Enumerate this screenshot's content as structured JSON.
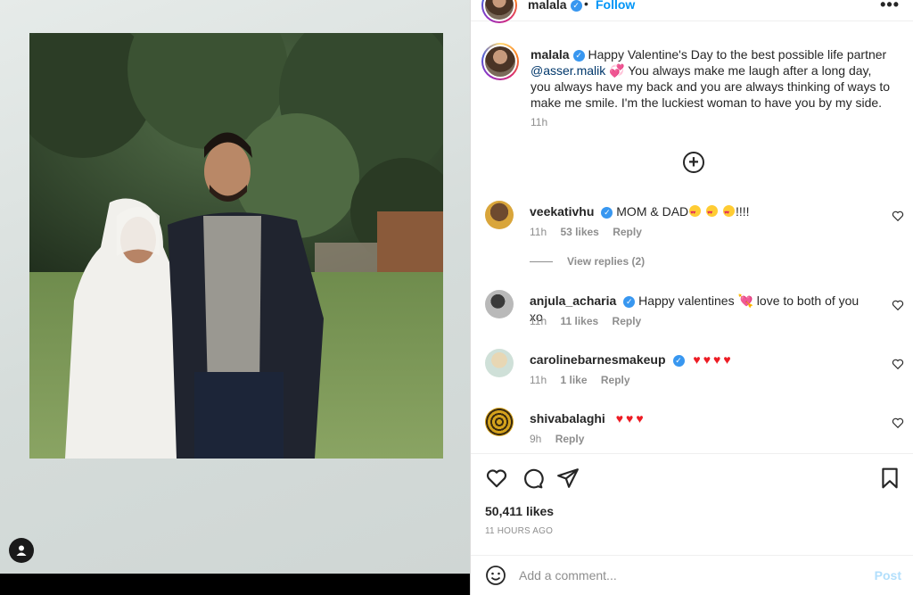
{
  "header": {
    "username": "malala",
    "separator": "•",
    "follow_label": "Follow",
    "more_label": "•••"
  },
  "caption": {
    "username": "malala",
    "text_before_mention": "Happy Valentine's Day to the best possible life partner",
    "mention": "@asser.malik",
    "text_after_mention": "You always make me laugh after a long day, you always have my back and you are always thinking of ways to make me smile. I'm the luckiest woman to have you by my side.",
    "time": "11h"
  },
  "comments": [
    {
      "username": "veekativhu",
      "verified": true,
      "text": "MOM & DAD",
      "suffix": "!!!!",
      "time": "11h",
      "likes": "53 likes",
      "reply": "Reply"
    },
    {
      "username": "anjula_acharia",
      "verified": true,
      "text": "Happy valentines",
      "suffix": "love to both of you xo",
      "time": "11h",
      "likes": "11 likes",
      "reply": "Reply"
    },
    {
      "username": "caroline barnes makeup",
      "display": "carolinebarnesmakeup",
      "verified": true,
      "text": "",
      "suffix": "",
      "time": "11h",
      "likes": "1 like",
      "reply": "Reply"
    },
    {
      "username": "shivabalaghi",
      "verified": false,
      "text": "",
      "suffix": "",
      "time": "9h",
      "likes": "",
      "reply": "Reply"
    }
  ],
  "view_replies": "View replies (2)",
  "likes": "50,411 likes",
  "post_time": "11 HOURS AGO",
  "add_comment": {
    "placeholder": "Add a comment...",
    "post_label": "Post"
  },
  "colors": {
    "link_blue": "#0095f6",
    "mention_blue": "#00376b",
    "muted": "#8e8e8e",
    "verified": "#3897f0",
    "heart_red": "#ed1c24",
    "post_disabled": "#b2dffc"
  },
  "icons": {
    "load_more": "plus-circle-icon",
    "like": "heart-outline-icon",
    "comment": "comment-bubble-icon",
    "share": "paper-plane-icon",
    "save": "bookmark-icon",
    "emoji": "smiley-icon",
    "user": "user-icon"
  }
}
